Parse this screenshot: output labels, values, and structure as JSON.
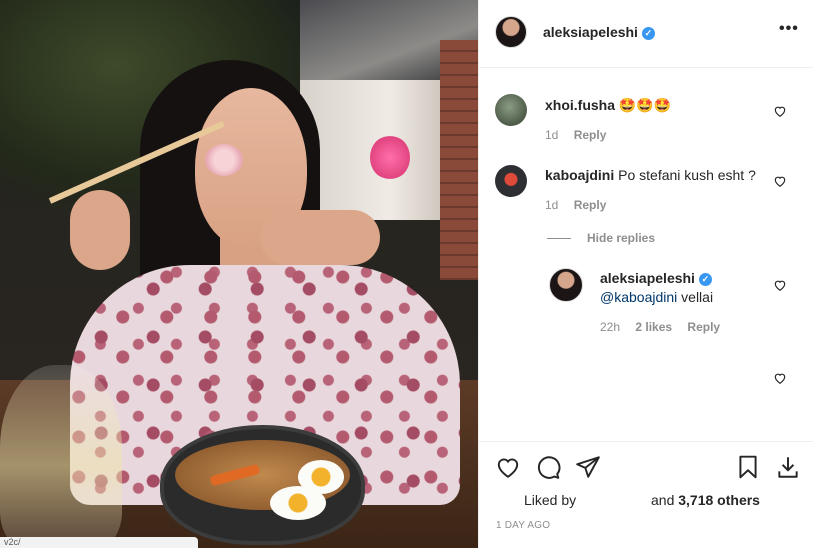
{
  "post": {
    "author": "aleksiapeleshi",
    "more_label": "•••",
    "photo_caption_overlay": "v2c/"
  },
  "comments": [
    {
      "user": "xhoi.fusha",
      "text": "🤩🤩🤩",
      "age": "1d",
      "reply_label": "Reply"
    },
    {
      "user": "kaboajdini",
      "text": "Po stefani kush esht ?",
      "age": "1d",
      "reply_label": "Reply"
    }
  ],
  "thread": {
    "hide_replies_label": "Hide replies",
    "reply": {
      "user": "aleksiapeleshi",
      "mention": "@kaboajdini",
      "text": " vellai",
      "age": "22h",
      "likes": "2 likes",
      "reply_label": "Reply"
    }
  },
  "footer": {
    "liked_by_label": "Liked by",
    "liked_count_prefix": "and ",
    "liked_count": "3,718 others",
    "timestamp": "1 DAY AGO"
  },
  "colors": {
    "verified_badge": "#3897f0",
    "muted_text": "#8e8e8e",
    "mention_link": "#00376b"
  }
}
